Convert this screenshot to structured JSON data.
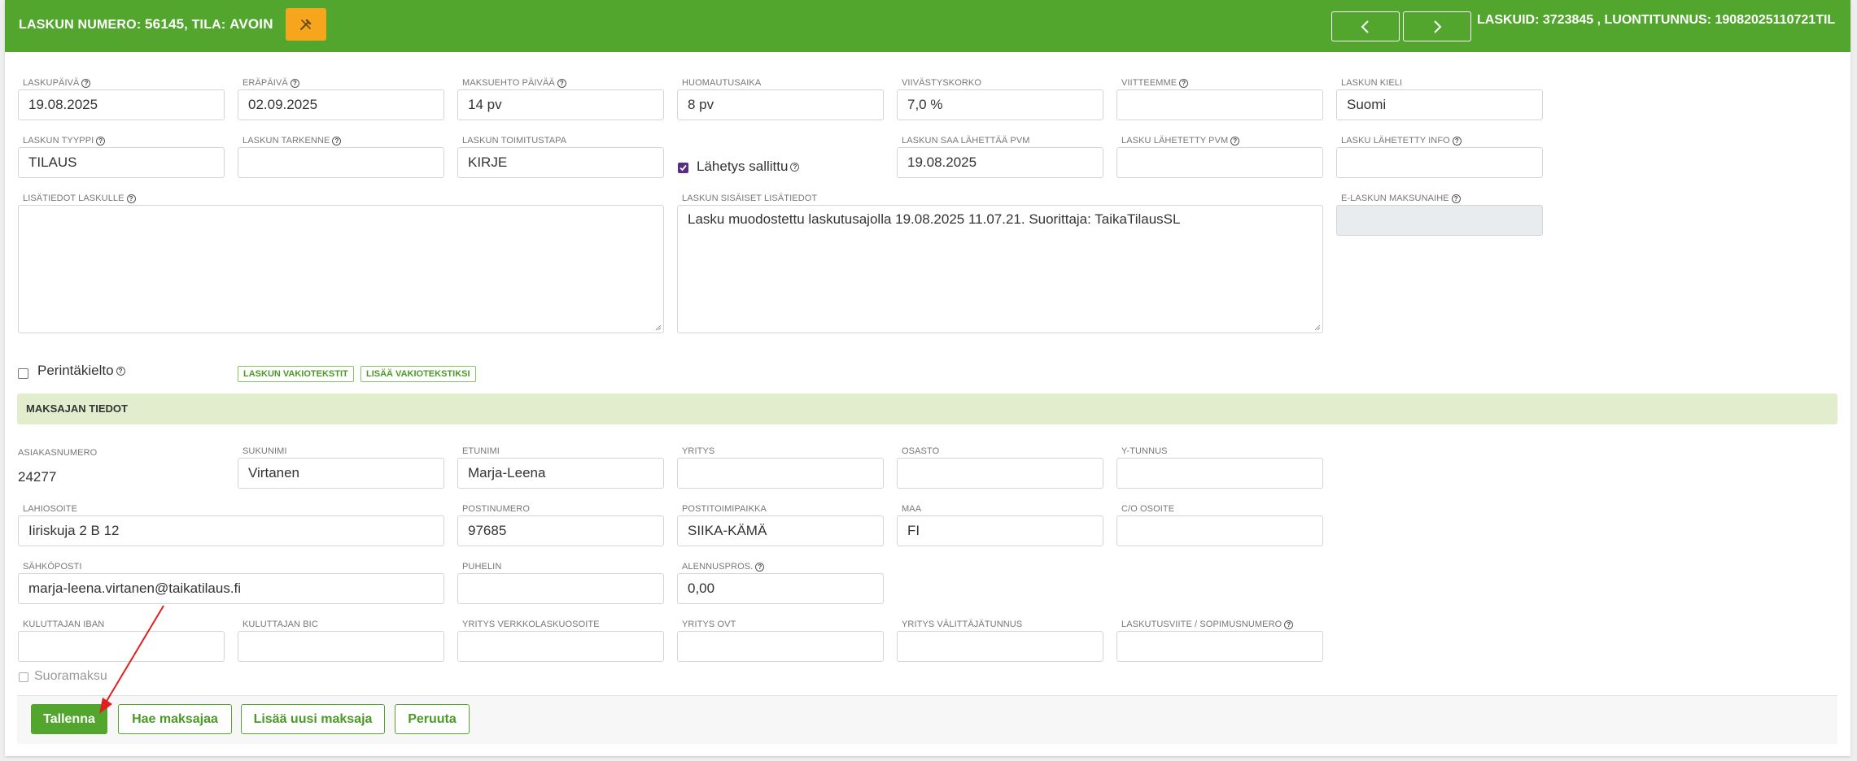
{
  "header": {
    "invoice_label": "LASKUN NUMERO:",
    "invoice_number": "56145",
    "status_label": ", TILA:",
    "status": "AVOIN",
    "right_info": "LASKUID: 3723845 , LUONTITUNNUS: 19082025110721TIL",
    "colors": {
      "header_bg": "#53a62d",
      "edit_button": "#f7a51c"
    }
  },
  "info_glyph": "?",
  "invoice": {
    "laskupaiva": {
      "label": "Laskupäivä",
      "value": "19.08.2025"
    },
    "erapaiva": {
      "label": "Eräpäivä",
      "value": "02.09.2025"
    },
    "maksuehto": {
      "label": "Maksuehto päivää",
      "value": "14 pv"
    },
    "huomautusaika": {
      "label": "Huomautusaika",
      "value": "8 pv"
    },
    "viivastyskorko": {
      "label": "Viivästyskorko",
      "value": "7,0 %"
    },
    "viitteemme": {
      "label": "Viitteemme",
      "value": ""
    },
    "laskun_kieli": {
      "label": "Laskun kieli",
      "value": "Suomi"
    },
    "laskun_tyyppi": {
      "label": "Laskun tyyppi",
      "value": "TILAUS"
    },
    "laskun_tarkenne": {
      "label": "Laskun tarkenne",
      "value": ""
    },
    "toimitustapa": {
      "label": "Laskun toimitustapa",
      "value": "KIRJE"
    },
    "lahetys_sallittu": {
      "label": "Lähetys sallittu",
      "checked": true
    },
    "saa_lahettaa_pvm": {
      "label": "Laskun saa lähettää pvm",
      "value": "19.08.2025"
    },
    "lahetetty_pvm": {
      "label": "Lasku lähetetty pvm",
      "value": ""
    },
    "lahetetty_info": {
      "label": "Lasku lähetetty info",
      "value": ""
    },
    "lisatiedot": {
      "label": "Lisätiedot laskulle",
      "value": ""
    },
    "sisaiset_lisatiedot": {
      "label": "Laskun sisäiset lisätiedot",
      "value": "Lasku muodostettu laskutusajolla 19.08.2025 11.07.21. Suorittaja: TaikaTilausSL"
    },
    "e_laskun_maksunaihe": {
      "label": "E-laskun maksunaihe",
      "value": ""
    },
    "perintakielto": {
      "label": "Perintäkielto",
      "checked": false
    },
    "btn_vakiotekstit": "Laskun vakiotekstit",
    "btn_lisaa_vakioteksti": "Lisää vakiotekstiksi"
  },
  "payer": {
    "section_title": "MAKSAJAN TIEDOT",
    "asiakasnumero": {
      "label": "Asiakasnumero",
      "value": "24277"
    },
    "sukunimi": {
      "label": "Sukunimi",
      "value": "Virtanen"
    },
    "etunimi": {
      "label": "Etunimi",
      "value": "Marja-Leena"
    },
    "yritys": {
      "label": "Yritys",
      "value": ""
    },
    "osasto": {
      "label": "Osasto",
      "value": ""
    },
    "ytunnus": {
      "label": "Y-tunnus",
      "value": ""
    },
    "lahiosoite": {
      "label": "Lahiosoite",
      "value": "Iiriskuja 2 B 12"
    },
    "postinumero": {
      "label": "Postinumero",
      "value": "97685"
    },
    "postitoimipaikka": {
      "label": "Postitoimipaikka",
      "value": "SIIKA-KÄMÄ"
    },
    "maa": {
      "label": "Maa",
      "value": "FI"
    },
    "co_osoite": {
      "label": "C/O Osoite",
      "value": ""
    },
    "sahkoposti": {
      "label": "Sähköposti",
      "value": "marja-leena.virtanen@taikatilaus.fi"
    },
    "puhelin": {
      "label": "Puhelin",
      "value": ""
    },
    "alennuspros": {
      "label": "Alennuspros.",
      "value": "0,00"
    },
    "iban": {
      "label": "Kuluttajan IBAN",
      "value": ""
    },
    "bic": {
      "label": "Kuluttajan BIC",
      "value": ""
    },
    "verkkolaskuosoite": {
      "label": "Yritys verkkolaskuosoite",
      "value": ""
    },
    "ovt": {
      "label": "Yritys OVT",
      "value": ""
    },
    "valittajatunnus": {
      "label": "Yritys välittäjätunnus",
      "value": ""
    },
    "laskutusviite": {
      "label": "Laskutusviite / sopimusnumero",
      "value": ""
    },
    "suoramaksu": {
      "label": "Suoramaksu",
      "checked": false
    }
  },
  "footer": {
    "save": "Tallenna",
    "find_payer": "Hae maksajaa",
    "add_payer": "Lisää uusi maksaja",
    "cancel": "Peruuta"
  }
}
